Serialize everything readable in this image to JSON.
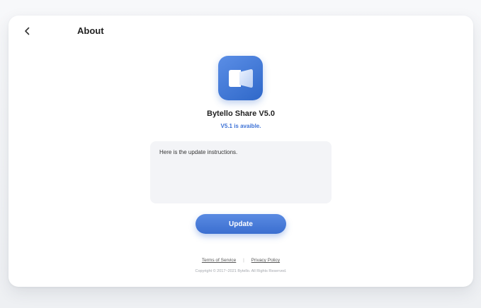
{
  "header": {
    "back_icon": "chevron-left-icon",
    "title": "About"
  },
  "app": {
    "icon": "bytello-share-logo-icon",
    "name": "Bytello Share V5.0",
    "update_notice": "V5.1 is avaible.",
    "accent_color": "#3d72d6"
  },
  "instructions": {
    "text": "Here is the update instructions."
  },
  "actions": {
    "update_label": "Update"
  },
  "footer": {
    "terms_label": "Terms of Service",
    "separator": "|",
    "privacy_label": "Privacy Policy",
    "copyright": "Copyright © 2017~2021 Bytello. All Rights Reserved."
  }
}
